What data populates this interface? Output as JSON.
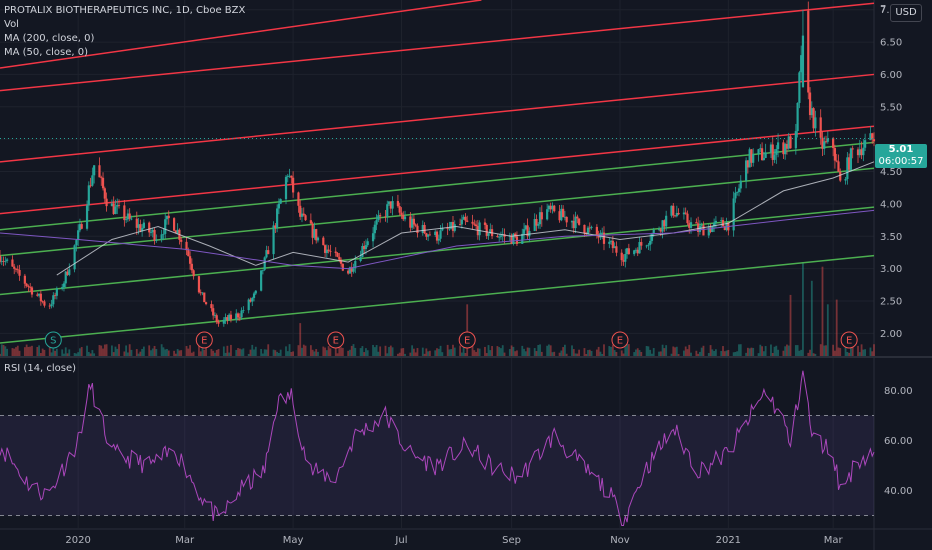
{
  "legend": {
    "title": "PROTALIX BIOTHERAPEUTICS INC, 1D, Cboe BZX",
    "vol": "Vol",
    "ma200": "MA (200, close, 0)",
    "ma50": "MA (50, close, 0)"
  },
  "currency": "USD",
  "price_axis_top_label": "7",
  "last_price": {
    "value": "5.01",
    "countdown": "06:00:57"
  },
  "rsi_legend": "RSI (14, close)",
  "colors": {
    "background": "#131722",
    "up": "#26a69a",
    "down": "#ef5350",
    "red_channel": "#f23645",
    "green_channel": "#4caf50",
    "ma50": "#d1d4dc",
    "ma200": "#7e57c2",
    "rsi": "#ab47bc",
    "rsi_band": "#7e57c2"
  },
  "chart_data": [
    {
      "type": "line",
      "subtype": "candlestick",
      "x_range": [
        "2019-11-18",
        "2021-03-24"
      ],
      "y_range": [
        1.65,
        7.15
      ],
      "y_ticks": [
        2.0,
        2.5,
        3.0,
        3.5,
        4.0,
        4.5,
        5.0,
        5.5,
        6.0,
        6.5,
        7.0
      ],
      "x_ticks": [
        {
          "date": "2020-01-01",
          "label": "2020"
        },
        {
          "date": "2020-03-01",
          "label": "Mar"
        },
        {
          "date": "2020-05-01",
          "label": "May"
        },
        {
          "date": "2020-07-01",
          "label": "Jul"
        },
        {
          "date": "2020-09-01",
          "label": "Sep"
        },
        {
          "date": "2020-11-01",
          "label": "Nov"
        },
        {
          "date": "2021-01-01",
          "label": "2021"
        },
        {
          "date": "2021-03-01",
          "label": "Mar"
        }
      ],
      "grid": true,
      "price_path": [
        [
          "2019-11-18",
          3.2
        ],
        [
          "2019-12-05",
          2.7
        ],
        [
          "2019-12-15",
          2.4
        ],
        [
          "2019-12-24",
          2.8
        ],
        [
          "2020-01-02",
          3.6
        ],
        [
          "2020-01-10",
          4.6
        ],
        [
          "2020-01-18",
          4.0
        ],
        [
          "2020-02-01",
          3.7
        ],
        [
          "2020-02-15",
          3.5
        ],
        [
          "2020-02-22",
          3.8
        ],
        [
          "2020-03-02",
          3.3
        ],
        [
          "2020-03-10",
          2.6
        ],
        [
          "2020-03-20",
          2.15
        ],
        [
          "2020-04-01",
          2.3
        ],
        [
          "2020-04-10",
          2.6
        ],
        [
          "2020-04-20",
          3.6
        ],
        [
          "2020-04-28",
          4.5
        ],
        [
          "2020-05-05",
          3.8
        ],
        [
          "2020-05-20",
          3.3
        ],
        [
          "2020-06-01",
          2.95
        ],
        [
          "2020-06-15",
          3.6
        ],
        [
          "2020-06-25",
          4.0
        ],
        [
          "2020-07-05",
          3.7
        ],
        [
          "2020-07-20",
          3.5
        ],
        [
          "2020-08-05",
          3.7
        ],
        [
          "2020-08-20",
          3.55
        ],
        [
          "2020-09-05",
          3.45
        ],
        [
          "2020-09-20",
          3.9
        ],
        [
          "2020-10-05",
          3.75
        ],
        [
          "2020-10-20",
          3.5
        ],
        [
          "2020-11-03",
          3.2
        ],
        [
          "2020-11-15",
          3.4
        ],
        [
          "2020-12-01",
          3.9
        ],
        [
          "2020-12-15",
          3.6
        ],
        [
          "2021-01-01",
          3.7
        ],
        [
          "2021-01-12",
          4.7
        ],
        [
          "2021-01-25",
          4.8
        ],
        [
          "2021-02-08",
          5.0
        ],
        [
          "2021-02-12",
          6.8
        ],
        [
          "2021-02-15",
          5.6
        ],
        [
          "2021-02-22",
          4.9
        ],
        [
          "2021-03-01",
          4.9
        ],
        [
          "2021-03-05",
          4.3
        ],
        [
          "2021-03-12",
          4.8
        ],
        [
          "2021-03-24",
          5.01
        ]
      ],
      "series": [
        {
          "name": "MA (50, close, 0)",
          "values": [
            [
              "2019-12-20",
              2.9
            ],
            [
              "2020-01-20",
              3.45
            ],
            [
              "2020-02-15",
              3.65
            ],
            [
              "2020-03-15",
              3.35
            ],
            [
              "2020-04-10",
              3.05
            ],
            [
              "2020-05-01",
              3.25
            ],
            [
              "2020-06-01",
              3.1
            ],
            [
              "2020-07-01",
              3.55
            ],
            [
              "2020-08-01",
              3.65
            ],
            [
              "2020-09-01",
              3.5
            ],
            [
              "2020-10-01",
              3.6
            ],
            [
              "2020-11-01",
              3.45
            ],
            [
              "2020-12-01",
              3.55
            ],
            [
              "2021-01-01",
              3.7
            ],
            [
              "2021-02-01",
              4.2
            ],
            [
              "2021-03-01",
              4.4
            ],
            [
              "2021-03-24",
              4.65
            ]
          ]
        },
        {
          "name": "MA (200, close, 0)",
          "values": [
            [
              "2019-11-18",
              3.55
            ],
            [
              "2020-01-01",
              3.45
            ],
            [
              "2020-03-01",
              3.3
            ],
            [
              "2020-05-01",
              3.05
            ],
            [
              "2020-06-01",
              3.0
            ],
            [
              "2020-08-01",
              3.35
            ],
            [
              "2020-10-01",
              3.5
            ],
            [
              "2020-12-01",
              3.55
            ],
            [
              "2021-01-01",
              3.65
            ],
            [
              "2021-02-01",
              3.75
            ],
            [
              "2021-03-24",
              3.9
            ]
          ]
        }
      ],
      "trend_lines": [
        {
          "color": "red",
          "start": [
            "2019-11-18",
            6.1
          ],
          "end": [
            "2020-08-15",
            7.15
          ]
        },
        {
          "color": "red",
          "start": [
            "2019-11-18",
            5.75
          ],
          "end": [
            "2021-03-24",
            7.1
          ]
        },
        {
          "color": "red",
          "start": [
            "2019-11-18",
            4.65
          ],
          "end": [
            "2021-03-24",
            6.0
          ]
        },
        {
          "color": "red",
          "start": [
            "2019-11-18",
            3.85
          ],
          "end": [
            "2021-03-24",
            5.2
          ]
        },
        {
          "color": "green",
          "start": [
            "2019-11-18",
            3.6
          ],
          "end": [
            "2021-03-24",
            4.95
          ]
        },
        {
          "color": "green",
          "start": [
            "2019-11-18",
            3.2
          ],
          "end": [
            "2021-03-24",
            4.55
          ]
        },
        {
          "color": "green",
          "start": [
            "2019-11-18",
            2.6
          ],
          "end": [
            "2021-03-24",
            3.95
          ]
        },
        {
          "color": "green",
          "start": [
            "2019-11-18",
            1.85
          ],
          "end": [
            "2021-03-24",
            3.2
          ]
        }
      ],
      "event_markers": [
        {
          "date": "2019-12-18",
          "label": "S"
        },
        {
          "date": "2020-03-12",
          "label": "E"
        },
        {
          "date": "2020-05-25",
          "label": "E"
        },
        {
          "date": "2020-08-07",
          "label": "E"
        },
        {
          "date": "2020-11-01",
          "label": "E"
        },
        {
          "date": "2021-03-10",
          "label": "E"
        }
      ],
      "volume_spikes": [
        [
          "2020-05-05",
          0.35
        ],
        [
          "2020-08-07",
          0.55
        ],
        [
          "2021-02-05",
          0.65
        ],
        [
          "2021-02-12",
          1.0
        ],
        [
          "2021-02-17",
          0.8
        ],
        [
          "2021-02-23",
          0.95
        ],
        [
          "2021-02-26",
          0.55
        ],
        [
          "2021-03-03",
          0.6
        ]
      ]
    },
    {
      "type": "line",
      "series": [
        {
          "name": "RSI (14, close)",
          "values": [
            [
              "2019-11-18",
              58
            ],
            [
              "2019-12-05",
              42
            ],
            [
              "2019-12-15",
              38
            ],
            [
              "2020-01-01",
              60
            ],
            [
              "2020-01-08",
              82
            ],
            [
              "2020-01-20",
              55
            ],
            [
              "2020-02-10",
              50
            ],
            [
              "2020-02-25",
              56
            ],
            [
              "2020-03-10",
              38
            ],
            [
              "2020-03-20",
              28
            ],
            [
              "2020-04-01",
              40
            ],
            [
              "2020-04-15",
              48
            ],
            [
              "2020-04-22",
              75
            ],
            [
              "2020-04-30",
              78
            ],
            [
              "2020-05-10",
              48
            ],
            [
              "2020-05-25",
              45
            ],
            [
              "2020-06-05",
              62
            ],
            [
              "2020-06-22",
              70
            ],
            [
              "2020-07-05",
              55
            ],
            [
              "2020-07-20",
              50
            ],
            [
              "2020-08-07",
              58
            ],
            [
              "2020-08-20",
              50
            ],
            [
              "2020-09-05",
              45
            ],
            [
              "2020-09-25",
              62
            ],
            [
              "2020-10-10",
              50
            ],
            [
              "2020-10-25",
              40
            ],
            [
              "2020-11-03",
              28
            ],
            [
              "2020-11-15",
              48
            ],
            [
              "2020-12-01",
              65
            ],
            [
              "2020-12-15",
              48
            ],
            [
              "2021-01-01",
              55
            ],
            [
              "2021-01-12",
              68
            ],
            [
              "2021-01-22",
              80
            ],
            [
              "2021-02-01",
              68
            ],
            [
              "2021-02-05",
              58
            ],
            [
              "2021-02-12",
              88
            ],
            [
              "2021-02-17",
              62
            ],
            [
              "2021-03-01",
              55
            ],
            [
              "2021-03-05",
              40
            ],
            [
              "2021-03-15",
              52
            ],
            [
              "2021-03-24",
              56
            ]
          ]
        }
      ],
      "y_range": [
        25,
        93
      ],
      "y_ticks": [
        40.0,
        60.0,
        80.0
      ],
      "bands": [
        30,
        70
      ]
    }
  ]
}
